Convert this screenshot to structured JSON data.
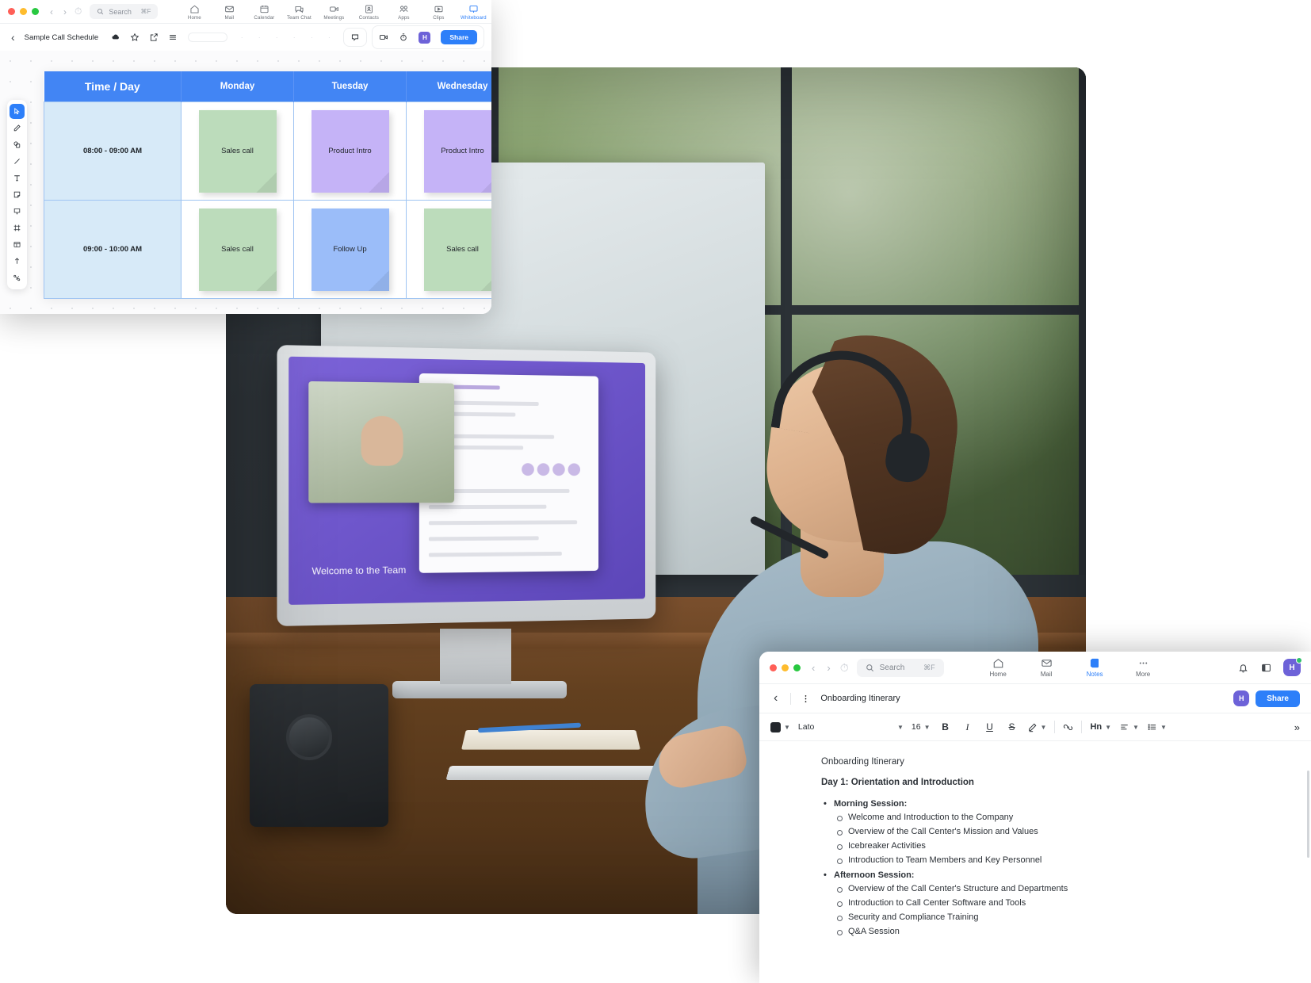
{
  "whiteboard_window": {
    "titlebar": {
      "search": {
        "placeholder": "Search",
        "shortcut": "⌘F"
      },
      "nav_items": [
        {
          "label": "Home",
          "icon": "home-icon"
        },
        {
          "label": "Mail",
          "icon": "mail-icon"
        },
        {
          "label": "Calendar",
          "icon": "calendar-icon"
        },
        {
          "label": "Team Chat",
          "icon": "chat-icon"
        },
        {
          "label": "Meetings",
          "icon": "video-icon"
        },
        {
          "label": "Contacts",
          "icon": "contacts-icon"
        },
        {
          "label": "Apps",
          "icon": "apps-icon"
        },
        {
          "label": "Clips",
          "icon": "clips-icon"
        },
        {
          "label": "Whiteboard",
          "icon": "whiteboard-icon"
        }
      ]
    },
    "subbar": {
      "doc_title": "Sample Call Schedule",
      "avatar_initial": "H",
      "share_label": "Share"
    },
    "tools": [
      "select-icon",
      "pen-icon",
      "shapes-icon",
      "line-icon",
      "text-icon",
      "sticky-note-icon",
      "comment-icon",
      "frame-icon",
      "table-icon",
      "upload-icon",
      "connector-icon"
    ],
    "table": {
      "headers": [
        "Time / Day",
        "Monday",
        "Tuesday",
        "Wednesday"
      ],
      "rows": [
        {
          "time": "08:00 - 09:00 AM",
          "cells": [
            {
              "label": "Sales call",
              "color": "#bcdcbb"
            },
            {
              "label": "Product Intro",
              "color": "#c5b3f7"
            },
            {
              "label": "Product Intro",
              "color": "#c5b3f7"
            }
          ]
        },
        {
          "time": "09:00 - 10:00 AM",
          "cells": [
            {
              "label": "Sales call",
              "color": "#bcdcbb"
            },
            {
              "label": "Follow Up",
              "color": "#9bbdf9"
            },
            {
              "label": "Sales call",
              "color": "#bcdcbb"
            }
          ]
        }
      ]
    }
  },
  "notes_window": {
    "titlebar": {
      "search": {
        "placeholder": "Search",
        "shortcut": "⌘F"
      },
      "nav_items": [
        {
          "label": "Home",
          "icon": "home-icon"
        },
        {
          "label": "Mail",
          "icon": "mail-icon"
        },
        {
          "label": "Notes",
          "icon": "notes-icon"
        },
        {
          "label": "More",
          "icon": "more-icon"
        }
      ],
      "avatar_initial": "H"
    },
    "docbar": {
      "doc_title": "Onboarding Itinerary",
      "avatar_initial": "H",
      "share_label": "Share"
    },
    "toolbar": {
      "text_color": "#23272c",
      "font_family": "Lato",
      "font_size": "16",
      "bold": "B",
      "italic": "I",
      "underline": "U",
      "strikethrough": "S",
      "heading": "Hn"
    },
    "document": {
      "title": "Onboarding Itinerary",
      "day_heading": "Day 1: Orientation and Introduction",
      "sections": [
        {
          "heading": "Morning Session:",
          "items": [
            "Welcome and Introduction to the Company",
            "Overview of the Call Center's Mission and Values",
            "Icebreaker Activities",
            "Introduction to Team Members and Key Personnel"
          ]
        },
        {
          "heading": "Afternoon Session:",
          "items": [
            "Overview of the Call Center's Structure and Departments",
            "Introduction to Call Center Software and Tools",
            "Security and Compliance Training",
            "Q&A Session"
          ]
        }
      ]
    }
  },
  "colors": {
    "accent": "#2d7ff9",
    "table_header": "#4285f4",
    "time_cell": "#d7eaf8",
    "sticky_green": "#bcdcbb",
    "sticky_purple": "#c5b3f7",
    "sticky_blue": "#9bbdf9"
  },
  "photo": {
    "alt": "call-center-agent-at-desk"
  }
}
